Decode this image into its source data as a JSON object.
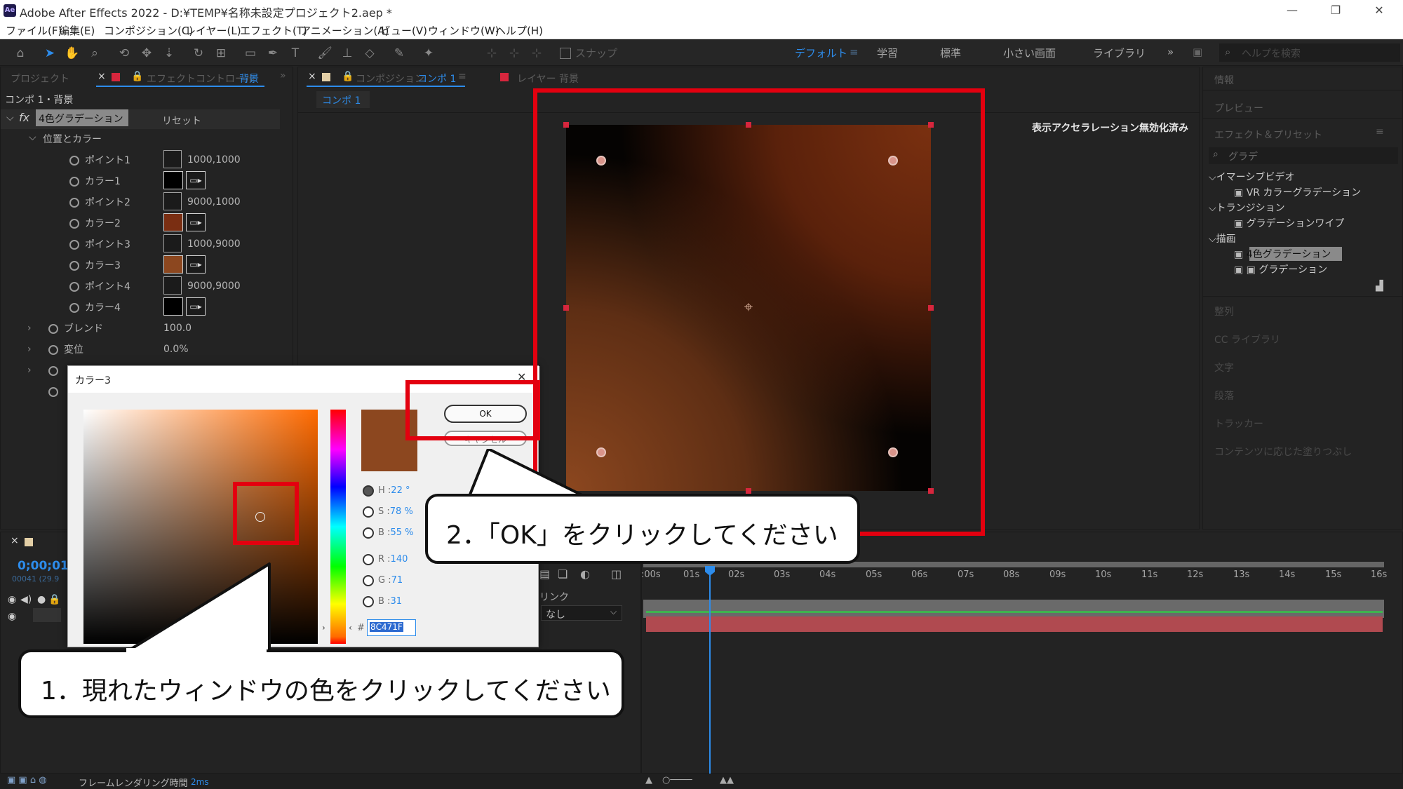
{
  "window": {
    "title": "Adobe After Effects 2022 - D:¥TEMP¥名称未設定プロジェクト2.aep *",
    "app_icon": "Ae",
    "controls": [
      "—",
      "❐",
      "✕"
    ]
  },
  "menu": [
    "ファイル(F)",
    "編集(E)",
    "コンポジション(C)",
    "レイヤー(L)",
    "エフェクト(T)",
    "アニメーション(A)",
    "ビュー(V)",
    "ウィンドウ(W)",
    "ヘルプ(H)"
  ],
  "toolbar": {
    "snap_label": "スナップ",
    "workspaces": [
      "デフォルト",
      "学習",
      "標準",
      "小さい画面",
      "ライブラリ"
    ],
    "search_placeholder": "ヘルプを検索"
  },
  "left_panel": {
    "tab_project": "プロジェクト",
    "tab_effect_controls": "エフェクトコントロール",
    "tab_effect_layer": "背景",
    "header": "コンポ 1・背景",
    "effect_name": "4色グラデーション",
    "reset_label": "リセット",
    "group_label": "位置とカラー",
    "properties": [
      {
        "label": "ポイント1",
        "value": "1000,1000",
        "kind": "point"
      },
      {
        "label": "カラー1",
        "kind": "color",
        "color": "#000000"
      },
      {
        "label": "ポイント2",
        "value": "9000,1000",
        "kind": "point"
      },
      {
        "label": "カラー2",
        "kind": "color",
        "color": "#7a2e12"
      },
      {
        "label": "ポイント3",
        "value": "1000,9000",
        "kind": "point"
      },
      {
        "label": "カラー3",
        "kind": "color",
        "color": "#8c471f"
      },
      {
        "label": "ポイント4",
        "value": "9000,9000",
        "kind": "point"
      },
      {
        "label": "カラー4",
        "kind": "color",
        "color": "#000000"
      }
    ],
    "blend_label": "ブレンド",
    "blend_value": "100.0",
    "jitter_label": "変位",
    "jitter_value": "0.0%"
  },
  "composition_panel": {
    "tab_label": "コンポジション",
    "tab_name": "コンポ 1",
    "layer_tab": "レイヤー 背景",
    "breadcrumb": "コンポ 1",
    "notice": "表示アクセラレーション無効化済み"
  },
  "right_panel": {
    "info": "情報",
    "preview": "プレビュー",
    "effects_presets": "エフェクト＆プリセット",
    "search_value": "グラデ",
    "categories": [
      {
        "name": "イマーシブビデオ",
        "items": [
          "VR カラーグラデーション"
        ]
      },
      {
        "name": "トランジション",
        "items": [
          "グラデーションワイプ"
        ]
      },
      {
        "name": "描画",
        "items": [
          "4色グラデーション",
          "グラデーション"
        ]
      }
    ],
    "collapsed": [
      "整列",
      "CC ライブラリ",
      "文字",
      "段落",
      "トラッカー",
      "コンテンツに応じた塗りつぶし"
    ]
  },
  "timeline": {
    "timecode": "0;00;01",
    "frame_info": "00041 (29.9",
    "parent_label": "リンク",
    "parent_value": "なし",
    "ticks": [
      ":00s",
      "01s",
      "02s",
      "03s",
      "04s",
      "05s",
      "06s",
      "07s",
      "08s",
      "09s",
      "10s",
      "11s",
      "12s",
      "13s",
      "14s",
      "15s",
      "16s"
    ]
  },
  "status_bar": {
    "render_label": "フレームレンダリング時間",
    "render_value": "2ms"
  },
  "color_picker": {
    "title": "カラー3",
    "ok_label": "OK",
    "cancel_label": "キャンセル",
    "h_label": "H :",
    "h_value": "22 °",
    "s_label": "S :",
    "s_value": "78 %",
    "b_label": "B :",
    "b_value": "55 %",
    "r_label": "R :",
    "r_value": "140",
    "g_label": "G :",
    "g_value": "71",
    "bl_label": "B :",
    "bl_value": "31",
    "hex_value": "8C471F",
    "current_color": "#8c471f"
  },
  "callouts": {
    "step1": "1．現れたウィンドウの色をクリックしてください",
    "step2": "2．「OK」をクリックしてください"
  }
}
